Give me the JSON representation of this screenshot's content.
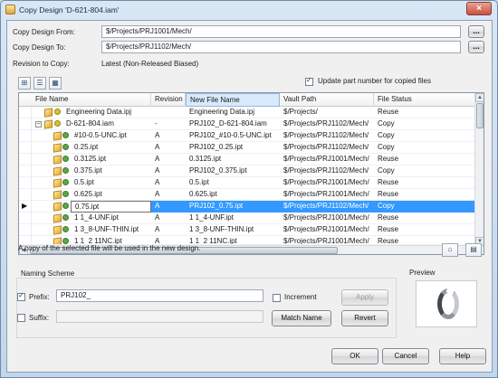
{
  "window": {
    "title": "Copy Design 'D-621-804.iam'"
  },
  "form": {
    "copy_from_label": "Copy Design From:",
    "copy_from_value": "$/Projects/PRJ1001/Mech/",
    "copy_to_label": "Copy Design To:",
    "copy_to_value": "$/Projects/PRJ1102/Mech/",
    "revision_label": "Revision to Copy:",
    "revision_value": "Latest (Non-Released Biased)",
    "browse_label": "...",
    "update_part_number_label": "Update part number for copied files",
    "update_part_number_checked": true
  },
  "table": {
    "columns": [
      "File Name",
      "Revision",
      "New File Name",
      "Vault Path",
      "File Status"
    ],
    "rows": [
      {
        "file_name": "Engineering Data.ipj",
        "revision": "",
        "new_file_name": "Engineering Data.ipj",
        "vault_path": "$/Projects/",
        "status": "Reuse"
      },
      {
        "file_name": "D-621-804.iam",
        "revision": "-",
        "new_file_name": "PRJ102_D-621-804.iam",
        "vault_path": "$/Projects/PRJ1102/Mech/",
        "status": "Copy"
      },
      {
        "file_name": "#10-0.5-UNC.ipt",
        "revision": "A",
        "new_file_name": "PRJ102_#10-0.5-UNC.ipt",
        "vault_path": "$/Projects/PRJ1102/Mech/",
        "status": "Copy"
      },
      {
        "file_name": "0.25.ipt",
        "revision": "A",
        "new_file_name": "PRJ102_0.25.ipt",
        "vault_path": "$/Projects/PRJ1102/Mech/",
        "status": "Copy"
      },
      {
        "file_name": "0.3125.ipt",
        "revision": "A",
        "new_file_name": "0.3125.ipt",
        "vault_path": "$/Projects/PRJ1001/Mech/",
        "status": "Reuse"
      },
      {
        "file_name": "0.375.ipt",
        "revision": "A",
        "new_file_name": "PRJ102_0.375.ipt",
        "vault_path": "$/Projects/PRJ1102/Mech/",
        "status": "Copy"
      },
      {
        "file_name": "0.5.ipt",
        "revision": "A",
        "new_file_name": "0.5.ipt",
        "vault_path": "$/Projects/PRJ1001/Mech/",
        "status": "Reuse"
      },
      {
        "file_name": "0.625.ipt",
        "revision": "A",
        "new_file_name": "0.625.ipt",
        "vault_path": "$/Projects/PRJ1001/Mech/",
        "status": "Reuse"
      },
      {
        "file_name": "0.75.ipt",
        "revision": "A",
        "new_file_name": "PRJ102_0.75.ipt",
        "vault_path": "$/Projects/PRJ1102/Mech/",
        "status": "Copy"
      },
      {
        "file_name": "1 1_4-UNF.ipt",
        "revision": "A",
        "new_file_name": "1 1_4-UNF.ipt",
        "vault_path": "$/Projects/PRJ1001/Mech/",
        "status": "Reuse"
      },
      {
        "file_name": "1 3_8-UNF-THIN.ipt",
        "revision": "A",
        "new_file_name": "1 3_8-UNF-THIN.ipt",
        "vault_path": "$/Projects/PRJ1001/Mech/",
        "status": "Reuse"
      },
      {
        "file_name": "1 1_2 11NC.ipt",
        "revision": "A",
        "new_file_name": "1 1_2 11NC.ipt",
        "vault_path": "$/Projects/PRJ1001/Mech/",
        "status": "Reuse"
      }
    ]
  },
  "description": "A copy of the selected file will be used in the new design.",
  "naming": {
    "group_title": "Naming Scheme",
    "prefix_label": "Prefix:",
    "prefix_value": "PRJ102_",
    "prefix_checked": true,
    "suffix_label": "Suffix:",
    "suffix_value": "",
    "suffix_checked": false,
    "increment_label": "Increment",
    "increment_checked": false,
    "apply_label": "Apply",
    "match_name_label": "Match Name",
    "revert_label": "Revert"
  },
  "preview": {
    "title": "Preview"
  },
  "buttons": {
    "ok": "OK",
    "cancel": "Cancel",
    "help": "Help"
  },
  "icons": {
    "close": "close-icon",
    "part": "part-icon",
    "assembly": "assembly-icon",
    "vault": "vault-status-icon"
  }
}
